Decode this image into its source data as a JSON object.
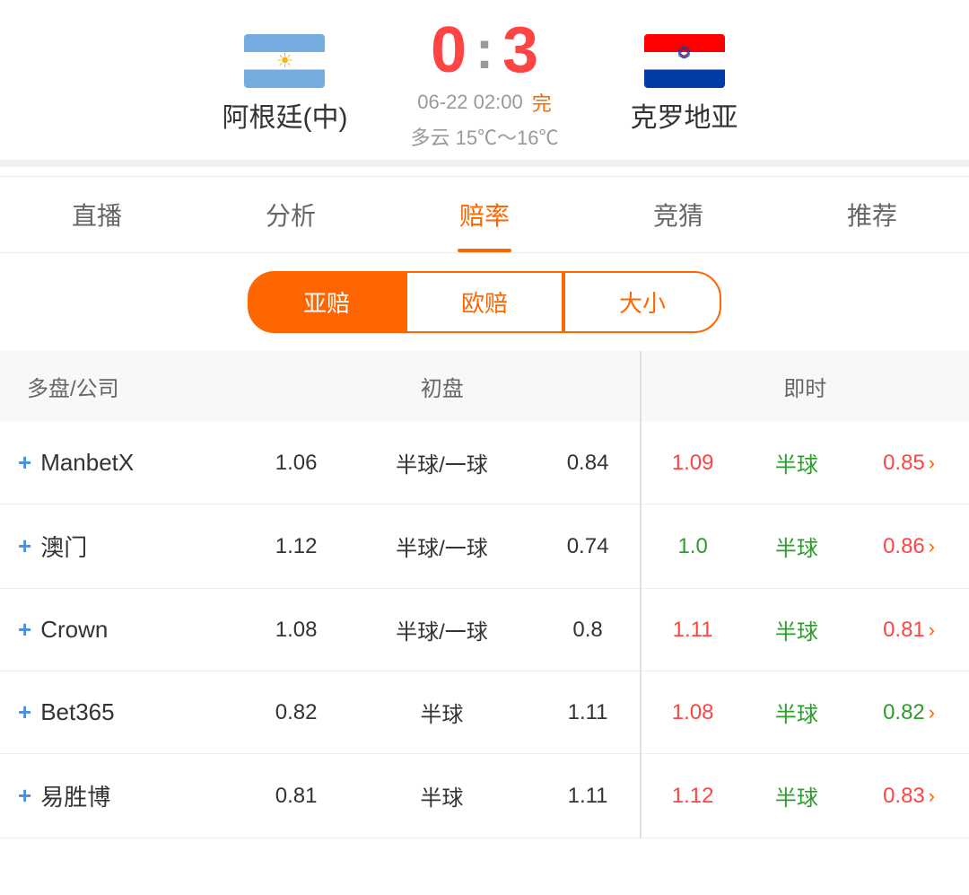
{
  "header": {
    "team_home": "阿根廷(中)",
    "team_away": "克罗地亚",
    "score_home": "0",
    "score_away": "3",
    "score_colon": ":",
    "datetime": "06-22 02:00",
    "status": "完",
    "weather": "多云  15℃～16℃"
  },
  "tabs": [
    {
      "label": "直播",
      "active": false
    },
    {
      "label": "分析",
      "active": false
    },
    {
      "label": "赔率",
      "active": true
    },
    {
      "label": "竞猜",
      "active": false
    },
    {
      "label": "推荐",
      "active": false
    }
  ],
  "sub_tabs": [
    {
      "label": "亚赔",
      "active": true
    },
    {
      "label": "欧赔",
      "active": false
    },
    {
      "label": "大小",
      "active": false
    }
  ],
  "table": {
    "col_headers": [
      "多盘/公司",
      "初盘",
      "",
      "",
      "即时",
      "",
      ""
    ],
    "rows": [
      {
        "company": "ManbetX",
        "init_home": "1.06",
        "init_handicap": "半球/一球",
        "init_away": "0.84",
        "live_home": "1.09",
        "live_home_color": "orange",
        "live_handicap": "半球",
        "live_away": "0.85",
        "live_away_color": "orange"
      },
      {
        "company": "澳门",
        "init_home": "1.12",
        "init_handicap": "半球/一球",
        "init_away": "0.74",
        "live_home": "1.0",
        "live_home_color": "green",
        "live_handicap": "半球",
        "live_away": "0.86",
        "live_away_color": "orange"
      },
      {
        "company": "Crown",
        "init_home": "1.08",
        "init_handicap": "半球/一球",
        "init_away": "0.8",
        "live_home": "1.11",
        "live_home_color": "orange",
        "live_handicap": "半球",
        "live_away": "0.81",
        "live_away_color": "orange"
      },
      {
        "company": "Bet365",
        "init_home": "0.82",
        "init_handicap": "半球",
        "init_away": "1.11",
        "live_home": "1.08",
        "live_home_color": "orange",
        "live_handicap": "半球",
        "live_away": "0.82",
        "live_away_color": "green"
      },
      {
        "company": "易胜博",
        "init_home": "0.81",
        "init_handicap": "半球",
        "init_away": "1.11",
        "live_home": "1.12",
        "live_home_color": "orange",
        "live_handicap": "半球",
        "live_away": "0.83",
        "live_away_color": "orange"
      }
    ]
  }
}
